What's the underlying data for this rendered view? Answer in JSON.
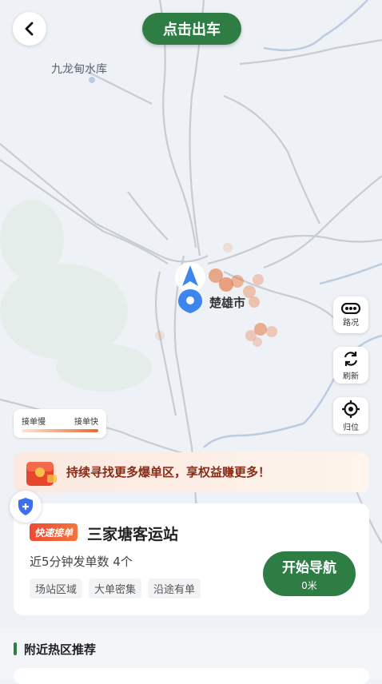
{
  "header": {
    "go_label": "点击出车"
  },
  "map": {
    "reservoir_label": "九龙甸水库",
    "city_label": "楚雄市"
  },
  "side_controls": [
    {
      "label": "路况",
      "icon": "traffic-icon"
    },
    {
      "label": "刷新",
      "icon": "refresh-icon"
    },
    {
      "label": "归位",
      "icon": "locate-icon"
    }
  ],
  "legend": {
    "slow": "接单慢",
    "fast": "接单快"
  },
  "promo": {
    "text": "持续寻找更多爆单区，享权益赚更多！"
  },
  "card": {
    "badge": "快速接单",
    "station": "三家塘客运站",
    "stat": "近5分钟发单数 4个",
    "tags": [
      "场站区域",
      "大单密集",
      "沿途有单"
    ],
    "nav_label": "开始导航",
    "nav_distance": "0米"
  },
  "nearby": {
    "title": "附近热区推荐"
  },
  "colors": {
    "brand_green": "#2e7d45",
    "heat_orange": "#e66a2f",
    "pin_blue": "#3d86ee"
  }
}
